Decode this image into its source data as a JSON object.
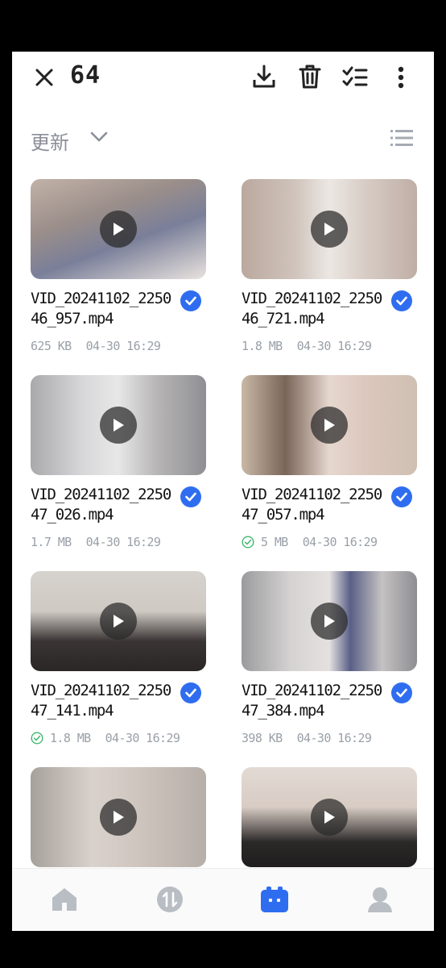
{
  "header": {
    "selected_count": "64",
    "close_icon": "close-icon",
    "download_icon": "download-icon",
    "delete_icon": "trash-icon",
    "select_all_icon": "checklist-icon",
    "more_icon": "more-vertical-icon"
  },
  "sort": {
    "label": "更新",
    "dropdown_icon": "chevron-down-icon",
    "view_icon": "list-view-icon"
  },
  "files": [
    {
      "name": "VID_20241102_225046_957.mp4",
      "size": "625 KB",
      "date": "04-30 16:29",
      "downloaded": false,
      "selected": true
    },
    {
      "name": "VID_20241102_225046_721.mp4",
      "size": "1.8 MB",
      "date": "04-30 16:29",
      "downloaded": false,
      "selected": true
    },
    {
      "name": "VID_20241102_225047_026.mp4",
      "size": "1.7 MB",
      "date": "04-30 16:29",
      "downloaded": false,
      "selected": true
    },
    {
      "name": "VID_20241102_225047_057.mp4",
      "size": "5 MB",
      "date": "04-30 16:29",
      "downloaded": true,
      "selected": true
    },
    {
      "name": "VID_20241102_225047_141.mp4",
      "size": "1.8 MB",
      "date": "04-30 16:29",
      "downloaded": true,
      "selected": true
    },
    {
      "name": "VID_20241102_225047_384.mp4",
      "size": "398 KB",
      "date": "04-30 16:29",
      "downloaded": false,
      "selected": true
    },
    {
      "name": "",
      "size": "",
      "date": "",
      "downloaded": false,
      "selected": false
    },
    {
      "name": "",
      "size": "",
      "date": "",
      "downloaded": false,
      "selected": false
    }
  ],
  "nav": [
    {
      "icon": "home-icon",
      "active": false
    },
    {
      "icon": "transfer-icon",
      "active": false
    },
    {
      "icon": "files-icon",
      "active": true
    },
    {
      "icon": "profile-icon",
      "active": false
    }
  ],
  "colors": {
    "accent": "#2f6df0",
    "muted": "#9aa0a8",
    "success": "#3cba6c"
  }
}
